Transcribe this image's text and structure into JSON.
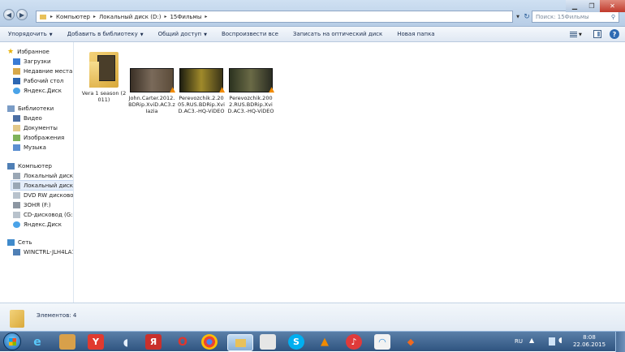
{
  "window": {
    "breadcrumb": [
      "Компьютер",
      "Локальный диск (D:)",
      "15Фильмы"
    ],
    "search_placeholder": "Поиск: 15Фильмы"
  },
  "toolbar": {
    "organize": "Упорядочить",
    "add_to_library": "Добавить в библиотеку",
    "share": "Общий доступ",
    "play_all": "Воспроизвести все",
    "burn": "Записать на оптический диск",
    "new_folder": "Новая папка"
  },
  "sidebar": {
    "favorites": {
      "label": "Избранное",
      "items": [
        "Загрузки",
        "Недавние места",
        "Рабочий стол",
        "Яндекс.Диск"
      ]
    },
    "libraries": {
      "label": "Библиотеки",
      "items": [
        "Видео",
        "Документы",
        "Изображения",
        "Музыка"
      ]
    },
    "computer": {
      "label": "Компьютер",
      "items": [
        "Локальный диск (C",
        "Локальный диск (D",
        "DVD RW дисковод (",
        "ЗОНЯ (F:)",
        "CD-дисковод (G:)",
        "Яндекс.Диск"
      ]
    },
    "network": {
      "label": "Сеть",
      "items": [
        "WINCTRL-JLH4LA1"
      ]
    }
  },
  "files": [
    {
      "name": "Vera 1 season (2011)",
      "type": "folder"
    },
    {
      "name": "John.Carter.2012.BDRip.XviD.AC3.zIazia",
      "type": "video"
    },
    {
      "name": "Perevozchik.2.2005.RUS.BDRip.XviD.AC3.-HQ-ViDEO",
      "type": "video"
    },
    {
      "name": "Perevozchik.2002.RUS.BDRip.XviD.AC3.-HQ-ViDEO",
      "type": "video"
    }
  ],
  "details": {
    "count_text": "Элементов: 4"
  },
  "taskbar": {
    "lang": "RU",
    "time": "8:08",
    "date": "22.06.2015"
  }
}
